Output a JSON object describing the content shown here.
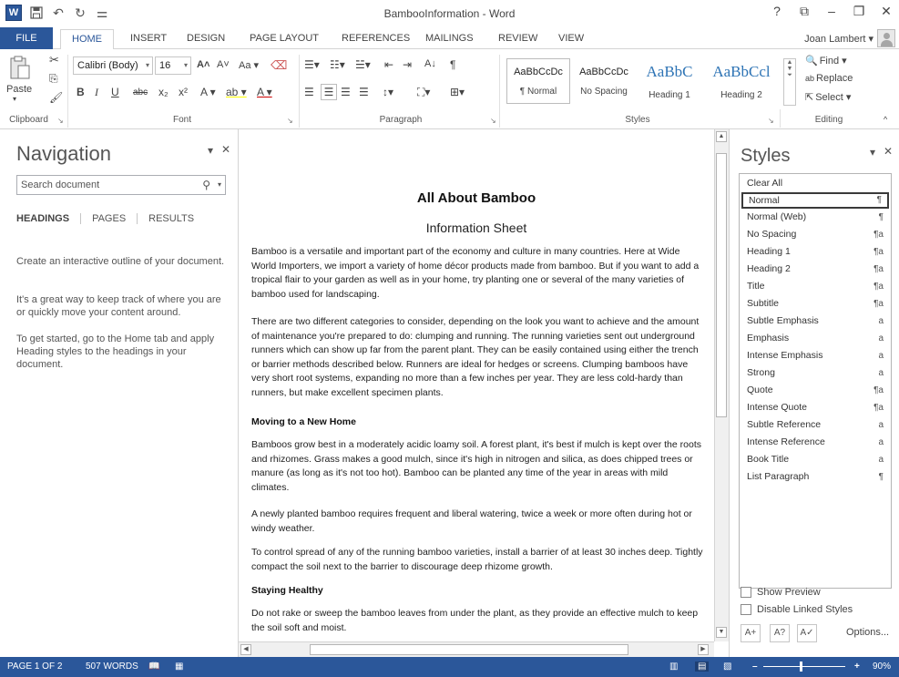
{
  "window": {
    "title": "BambooInformation - Word",
    "qat_icons": [
      "save-icon",
      "undo-icon",
      "redo-icon",
      "customize-qat-icon"
    ],
    "controls": [
      "?",
      "⧉",
      "–",
      "⧉",
      "✕"
    ]
  },
  "tabs": {
    "file": "FILE",
    "items": [
      "HOME",
      "INSERT",
      "DESIGN",
      "PAGE LAYOUT",
      "REFERENCES",
      "MAILINGS",
      "REVIEW",
      "VIEW"
    ],
    "active": "HOME",
    "user": "Joan Lambert ▾"
  },
  "ribbon": {
    "clipboard": {
      "label": "Clipboard",
      "paste": "Paste"
    },
    "font": {
      "label": "Font",
      "name": "Calibri (Body)",
      "size": "16",
      "grow": "A˄",
      "shrink": "A˅",
      "case": "Aa ▾",
      "bold": "B",
      "italic": "I",
      "underline": "U",
      "strike": "abc",
      "sub": "x₂",
      "sup": "x²",
      "effects": "A ▾",
      "highlight": "ab ▾",
      "color": "A ▾"
    },
    "paragraph": {
      "label": "Paragraph"
    },
    "styles": {
      "label": "Styles",
      "gallery": [
        {
          "preview": "AaBbCcDc",
          "name": "¶ Normal",
          "big": false
        },
        {
          "preview": "AaBbCcDc",
          "name": "No Spacing",
          "big": false
        },
        {
          "preview": "AaBbC",
          "name": "Heading 1",
          "big": true
        },
        {
          "preview": "AaBbCcl",
          "name": "Heading 2",
          "big": true
        }
      ]
    },
    "editing": {
      "label": "Editing",
      "find": "Find ▾",
      "replace": "Replace",
      "select": "Select ▾"
    }
  },
  "navigation": {
    "title": "Navigation",
    "search_placeholder": "Search document",
    "tabs": [
      "HEADINGS",
      "PAGES",
      "RESULTS"
    ],
    "paragraphs": [
      "Create an interactive outline of your document.",
      "It's a great way to keep track of where you are or quickly move your content around.",
      "To get started, go to the Home tab and apply Heading styles to the headings in your document."
    ]
  },
  "document": {
    "title": "All About Bamboo",
    "subtitle": "Information Sheet",
    "paragraphs": [
      {
        "type": "body",
        "text": "Bamboo is a versatile and important part of the economy and culture in many countries. Here at Wide World Importers, we import a variety of home décor products made from bamboo. But if you want to add a tropical flair to your garden as well as in your home, try planting one or several of the many varieties of bamboo used for landscaping."
      },
      {
        "type": "body",
        "text": "There are two different categories to consider, depending on the look you want to achieve and the amount of maintenance you're prepared to do: clumping and running. The running varieties sent out underground runners which can show up far from the parent plant. They can be easily contained using either the trench or barrier methods described below. Runners are ideal for hedges or screens. Clumping bamboos have very short root systems, expanding no more than a few inches per year. They are less cold-hardy than runners, but make excellent specimen plants."
      },
      {
        "type": "heading",
        "text": "Moving to a New Home"
      },
      {
        "type": "body",
        "text": "Bamboos grow best in a moderately acidic loamy soil. A forest plant, it's best if mulch is kept over the roots and rhizomes. Grass makes a good mulch, since it's high in nitrogen and silica, as does chipped trees or manure (as long as it's not too hot). Bamboo can be planted any time of the year in areas with mild climates."
      },
      {
        "type": "body",
        "text": "A newly planted bamboo requires frequent and liberal watering, twice a week or more often during hot or windy weather."
      },
      {
        "type": "body",
        "text": "To control spread of any of the running bamboo varieties, install a barrier of at least 30 inches deep. Tightly compact the soil next to the barrier to discourage deep rhizome growth."
      },
      {
        "type": "heading",
        "text": "Staying Healthy"
      },
      {
        "type": "body",
        "text": "Do not rake or sweep the bamboo leaves from under the plant, as they provide an effective mulch to keep the soil soft and moist."
      }
    ]
  },
  "styles_pane": {
    "title": "Styles",
    "items": [
      {
        "name": "Clear All",
        "mark": ""
      },
      {
        "name": "Normal",
        "mark": "¶"
      },
      {
        "name": "Normal (Web)",
        "mark": "¶"
      },
      {
        "name": "No Spacing",
        "mark": "¶a"
      },
      {
        "name": "Heading 1",
        "mark": "¶a"
      },
      {
        "name": "Heading 2",
        "mark": "¶a"
      },
      {
        "name": "Title",
        "mark": "¶a"
      },
      {
        "name": "Subtitle",
        "mark": "¶a"
      },
      {
        "name": "Subtle Emphasis",
        "mark": "a"
      },
      {
        "name": "Emphasis",
        "mark": "a"
      },
      {
        "name": "Intense Emphasis",
        "mark": "a"
      },
      {
        "name": "Strong",
        "mark": "a"
      },
      {
        "name": "Quote",
        "mark": "¶a"
      },
      {
        "name": "Intense Quote",
        "mark": "¶a"
      },
      {
        "name": "Subtle Reference",
        "mark": "a"
      },
      {
        "name": "Intense Reference",
        "mark": "a"
      },
      {
        "name": "Book Title",
        "mark": "a"
      },
      {
        "name": "List Paragraph",
        "mark": "¶"
      }
    ],
    "selected": "Normal",
    "show_preview": "Show Preview",
    "disable_linked": "Disable Linked Styles",
    "options": "Options..."
  },
  "status": {
    "page": "PAGE 1 OF 2",
    "words": "507 WORDS",
    "zoom": "90%",
    "zoom_minus": "–",
    "zoom_plus": "+"
  },
  "colors": {
    "accent": "#2b579a",
    "heading_blue": "#2e74b5"
  }
}
